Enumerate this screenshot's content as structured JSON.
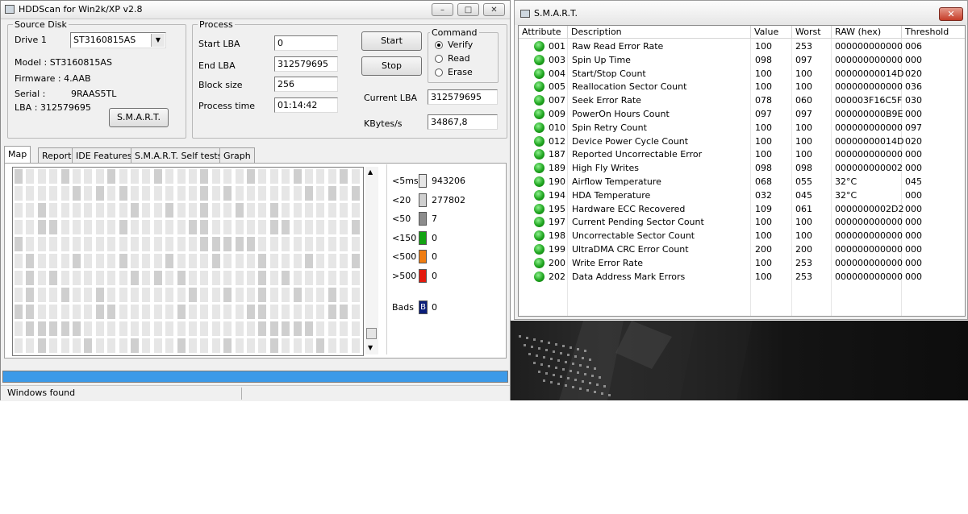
{
  "hddscan": {
    "title": "HDDScan for Win2k/XP  v2.8",
    "source_disk": {
      "legend": "Source Disk",
      "drive_label": "Drive  1",
      "drive_value": "ST3160815AS",
      "model": "Model : ST3160815AS",
      "firmware": "Firmware : 4.AAB",
      "serial_label": "Serial :",
      "serial_value": "9RAAS5TL",
      "lba": "LBA :  312579695",
      "smart_button": "S.M.A.R.T."
    },
    "process": {
      "legend": "Process",
      "start_lba_label": "Start LBA",
      "start_lba": "0",
      "end_lba_label": "End LBA",
      "end_lba": "312579695",
      "block_size_label": "Block size",
      "block_size": "256",
      "process_time_label": "Process time",
      "process_time": "01:14:42",
      "start_button": "Start",
      "stop_button": "Stop",
      "current_lba_label": "Current LBA",
      "current_lba": "312579695",
      "kbytes_label": "KBytes/s",
      "kbytes": "34867,8"
    },
    "command": {
      "legend": "Command",
      "options": [
        "Verify",
        "Read",
        "Erase"
      ],
      "selected": "Verify"
    },
    "tabs": [
      "Map",
      "Report",
      "IDE Features",
      "S.M.A.R.T. Self tests",
      "Graph"
    ],
    "active_tab": "Map",
    "legend": [
      {
        "label": "<5ms",
        "value": "943206",
        "color": "#e6e6e6"
      },
      {
        "label": "<20",
        "value": "277802",
        "color": "#cfcfcf"
      },
      {
        "label": "<50",
        "value": "7",
        "color": "#8c8c8c"
      },
      {
        "label": "<150",
        "value": "0",
        "color": "#13a313"
      },
      {
        "label": "<500",
        "value": "0",
        "color": "#f07d12"
      },
      {
        "label": ">500",
        "value": "0",
        "color": "#e31a0e"
      }
    ],
    "bads": {
      "label": "Bads",
      "icon": "B",
      "value": "0",
      "color": "#0a1e7a"
    },
    "progress": 1.0,
    "status": "Windows found"
  },
  "smart": {
    "title": "S.M.A.R.T.",
    "columns": [
      "Attribute",
      "Description",
      "Value",
      "Worst",
      "RAW (hex)",
      "Threshold"
    ],
    "rows": [
      [
        "001",
        "Raw Read Error Rate",
        "100",
        "253",
        "000000000000",
        "006"
      ],
      [
        "003",
        "Spin Up Time",
        "098",
        "097",
        "000000000000",
        "000"
      ],
      [
        "004",
        "Start/Stop Count",
        "100",
        "100",
        "00000000014D",
        "020"
      ],
      [
        "005",
        "Reallocation Sector Count",
        "100",
        "100",
        "000000000000",
        "036"
      ],
      [
        "007",
        "Seek Error Rate",
        "078",
        "060",
        "000003F16C5F",
        "030"
      ],
      [
        "009",
        "PowerOn Hours Count",
        "097",
        "097",
        "000000000B9E",
        "000"
      ],
      [
        "010",
        "Spin Retry Count",
        "100",
        "100",
        "000000000000",
        "097"
      ],
      [
        "012",
        "Device Power Cycle Count",
        "100",
        "100",
        "00000000014D",
        "020"
      ],
      [
        "187",
        "Reported Uncorrectable Error",
        "100",
        "100",
        "000000000000",
        "000"
      ],
      [
        "189",
        "High Fly Writes",
        "098",
        "098",
        "000000000002",
        "000"
      ],
      [
        "190",
        "Airflow Temperature",
        "068",
        "055",
        "32°C",
        "045"
      ],
      [
        "194",
        "HDA Temperature",
        "032",
        "045",
        "32°C",
        "000"
      ],
      [
        "195",
        "Hardware ECC Recovered",
        "109",
        "061",
        "0000000002D2",
        "000"
      ],
      [
        "197",
        "Current Pending Sector Count",
        "100",
        "100",
        "000000000000",
        "000"
      ],
      [
        "198",
        "Uncorrectable Sector Count",
        "100",
        "100",
        "000000000000",
        "000"
      ],
      [
        "199",
        "UltraDMA CRC Error Count",
        "200",
        "200",
        "000000000000",
        "000"
      ],
      [
        "200",
        "Write Error Rate",
        "100",
        "253",
        "000000000000",
        "000"
      ],
      [
        "202",
        "Data Address Mark Errors",
        "100",
        "253",
        "000000000000",
        "000"
      ]
    ],
    "status_color": "#1fa51f"
  }
}
